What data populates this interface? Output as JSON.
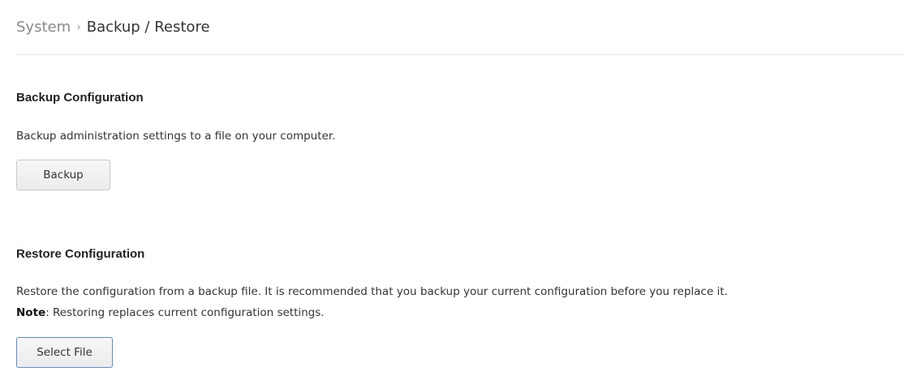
{
  "breadcrumb": {
    "parent": "System",
    "separator": "›",
    "current": "Backup / Restore"
  },
  "backup": {
    "title": "Backup Configuration",
    "description": "Backup administration settings to a file on your computer.",
    "button_label": "Backup"
  },
  "restore": {
    "title": "Restore Configuration",
    "description": "Restore the configuration from a backup file. It is recommended that you backup your current configuration before you replace it.",
    "note_label": "Note",
    "note_text": ": Restoring replaces current configuration settings.",
    "button_label": "Select File"
  },
  "colors": {
    "select_button_border": "#5b8ec4",
    "divider": "#e3e3e3"
  }
}
